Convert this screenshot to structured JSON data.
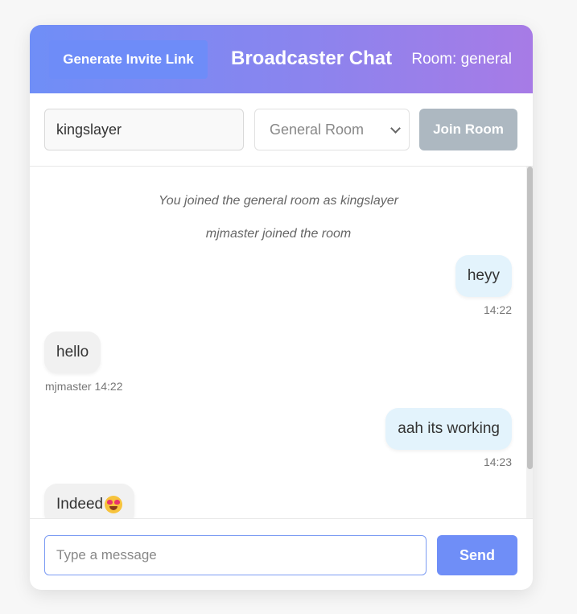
{
  "header": {
    "invite_label": "Generate Invite Link",
    "title": "Broadcaster Chat",
    "room_label": "Room: general"
  },
  "controls": {
    "username_value": "kingslayer",
    "room_select_value": "General Room",
    "join_label": "Join Room"
  },
  "messages": {
    "system": [
      "You joined the general room as kingslayer",
      "mjmaster joined the room"
    ],
    "items": [
      {
        "text": "heyy",
        "meta": "14:22",
        "direction": "sent"
      },
      {
        "text": "hello",
        "meta": "mjmaster 14:22",
        "direction": "received"
      },
      {
        "text": "aah its working",
        "meta": "14:23",
        "direction": "sent"
      },
      {
        "text": "Indeed",
        "emoji": "heart-eyes-emoji",
        "direction": "received"
      }
    ]
  },
  "composer": {
    "placeholder": "Type a message",
    "send_label": "Send"
  },
  "colors": {
    "header_gradient_start": "#6f8ef7",
    "header_gradient_end": "#a77be6",
    "accent": "#6f8ef7",
    "join_disabled": "#adb8c1",
    "sent_bubble": "#e3f3fc",
    "received_bubble": "#f1f1f1"
  }
}
